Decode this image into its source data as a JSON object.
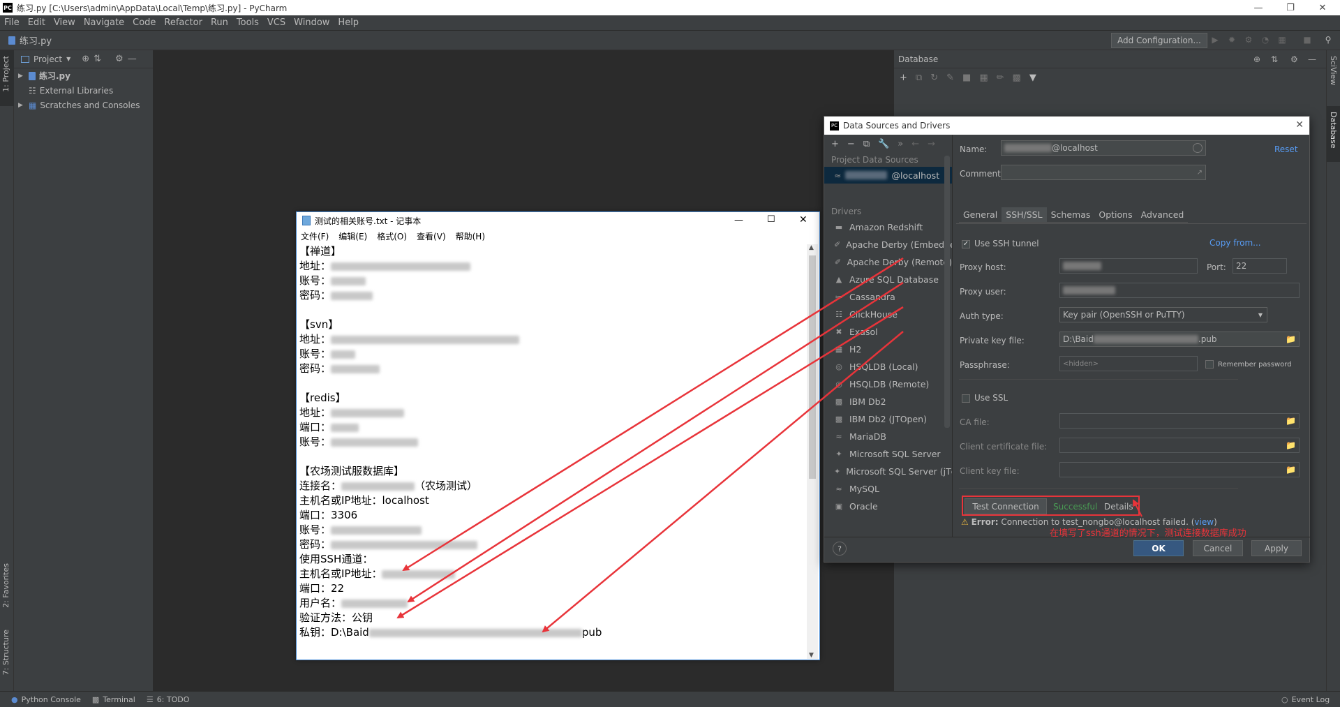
{
  "window": {
    "title": "练习.py [C:\\Users\\admin\\AppData\\Local\\Temp\\练习.py] - PyCharm",
    "logo": "PC"
  },
  "menu": [
    "File",
    "Edit",
    "View",
    "Navigate",
    "Code",
    "Refactor",
    "Run",
    "Tools",
    "VCS",
    "Window",
    "Help"
  ],
  "breadcrumb": "练习.py",
  "toolbar": {
    "add_config": "Add Configuration..."
  },
  "left_tabs": {
    "project": "1: Project",
    "favorites": "2: Favorites",
    "structure": "7: Structure"
  },
  "right_tabs": {
    "sciview": "SciView",
    "database": "Database"
  },
  "project_panel": {
    "title": "Project",
    "items": [
      {
        "label": "练习.py"
      },
      {
        "label": "External Libraries"
      },
      {
        "label": "Scratches and Consoles"
      }
    ]
  },
  "db_panel": {
    "title": "Database"
  },
  "status": {
    "python_console": "Python Console",
    "terminal": "Terminal",
    "todo": "6: TODO",
    "event_log": "Event Log"
  },
  "notepad": {
    "title": "测试的相关账号.txt - 记事本",
    "menu": [
      "文件(F)",
      "编辑(E)",
      "格式(O)",
      "查看(V)",
      "帮助(H)"
    ],
    "lines": [
      {
        "label": "【禅道】",
        "blur": 0
      },
      {
        "label": "地址：",
        "blur": 200
      },
      {
        "label": "账号：",
        "blur": 50
      },
      {
        "label": "密码：",
        "blur": 60
      },
      {
        "label": "",
        "blur": 0
      },
      {
        "label": "【svn】",
        "blur": 0
      },
      {
        "label": "地址：",
        "blur": 270
      },
      {
        "label": "账号：",
        "blur": 35
      },
      {
        "label": "密码：",
        "blur": 70
      },
      {
        "label": "",
        "blur": 0
      },
      {
        "label": "【redis】",
        "blur": 0
      },
      {
        "label": "地址：",
        "blur": 105
      },
      {
        "label": "端口：",
        "blur": 40
      },
      {
        "label": "账号：",
        "blur": 125
      },
      {
        "label": "",
        "blur": 0
      },
      {
        "label": "【农场测试服数据库】",
        "blur": 0
      },
      {
        "label": "连接名：",
        "blur": 105,
        "suffix": "（农场测试）"
      },
      {
        "label": "主机名或IP地址：localhost",
        "blur": 0
      },
      {
        "label": "端口：3306",
        "blur": 0
      },
      {
        "label": "账号：",
        "blur": 130
      },
      {
        "label": "密码：",
        "blur": 210
      },
      {
        "label": "使用SSH通道：",
        "blur": 0
      },
      {
        "label": "主机名或IP地址：",
        "blur": 105
      },
      {
        "label": "端口：22",
        "blur": 0
      },
      {
        "label": "用户名：",
        "blur": 95
      },
      {
        "label": "验证方法：公钥",
        "blur": 0
      },
      {
        "label": "私钥：D:\\Baid",
        "blur": 305,
        "suffix": "pub"
      }
    ]
  },
  "dialog": {
    "title": "Data Sources and Drivers",
    "project_sources_label": "Project Data Sources",
    "source_item": "@localhost",
    "drivers_label": "Drivers",
    "drivers": [
      "Amazon Redshift",
      "Apache Derby (Embedded)",
      "Apache Derby (Remote)",
      "Azure SQL Database",
      "Cassandra",
      "ClickHouse",
      "Exasol",
      "H2",
      "HSQLDB (Local)",
      "HSQLDB (Remote)",
      "IBM Db2",
      "IBM Db2 (JTOpen)",
      "MariaDB",
      "Microsoft SQL Server",
      "Microsoft SQL Server (jTds)",
      "MySQL",
      "Oracle"
    ],
    "name_label": "Name:",
    "name_value": "@localhost",
    "reset": "Reset",
    "comment_label": "Comment:",
    "tabs": [
      "General",
      "SSH/SSL",
      "Schemas",
      "Options",
      "Advanced"
    ],
    "use_ssh": "Use SSH tunnel",
    "copy_from": "Copy from...",
    "proxy_host_label": "Proxy host:",
    "port_label": "Port:",
    "port_value": "22",
    "proxy_user_label": "Proxy user:",
    "auth_type_label": "Auth type:",
    "auth_type_value": "Key pair (OpenSSH or PuTTY)",
    "private_key_label": "Private key file:",
    "private_key_value_start": "D:\\Baid",
    "private_key_value_end": ".pub",
    "passphrase_label": "Passphrase:",
    "passphrase_value": "<hidden>",
    "remember_password": "Remember password",
    "use_ssl": "Use SSL",
    "ca_file": "CA file:",
    "client_cert": "Client certificate file:",
    "client_key": "Client key file:",
    "test_connection": "Test Connection",
    "successful": "Successful",
    "details": "Details",
    "annotation": "在填写了ssh通道的情况下，测试连接数据库成功",
    "error_label": "Error:",
    "error_text": "Connection to test_nongbo@localhost failed.",
    "error_view": "view",
    "ok": "OK",
    "cancel": "Cancel",
    "apply": "Apply",
    "help": "?"
  },
  "colors": {
    "ide_bg": "#2b2b2b",
    "panel_bg": "#3c3f41",
    "accent": "#365880",
    "link": "#589df6",
    "success": "#499c54",
    "annotation": "#e8343a"
  }
}
